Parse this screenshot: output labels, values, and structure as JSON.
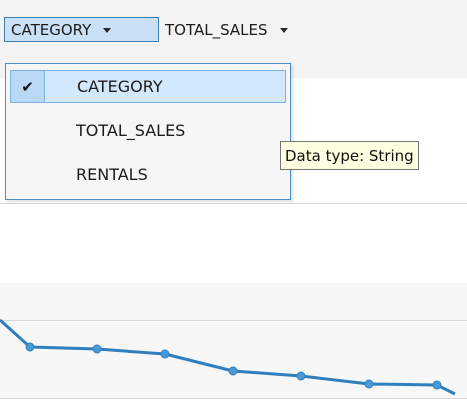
{
  "toolbar": {
    "selectors": [
      {
        "label": "CATEGORY",
        "active": true
      },
      {
        "label": "TOTAL_SALES",
        "active": false
      }
    ]
  },
  "dropdown": {
    "items": [
      {
        "label": "CATEGORY",
        "checked": true
      },
      {
        "label": "TOTAL_SALES",
        "checked": false
      },
      {
        "label": "RENTALS",
        "checked": false
      }
    ],
    "check_icon": "check-icon"
  },
  "tooltip": {
    "text": "Data type: String"
  },
  "chart": {
    "series_color": "#2f7fbf",
    "marker_color": "#4a9ad8"
  },
  "colors": {
    "accent_border": "#3c7fb1",
    "selection_fill": "#c9e0f7",
    "tooltip_fill": "#fefee0"
  }
}
